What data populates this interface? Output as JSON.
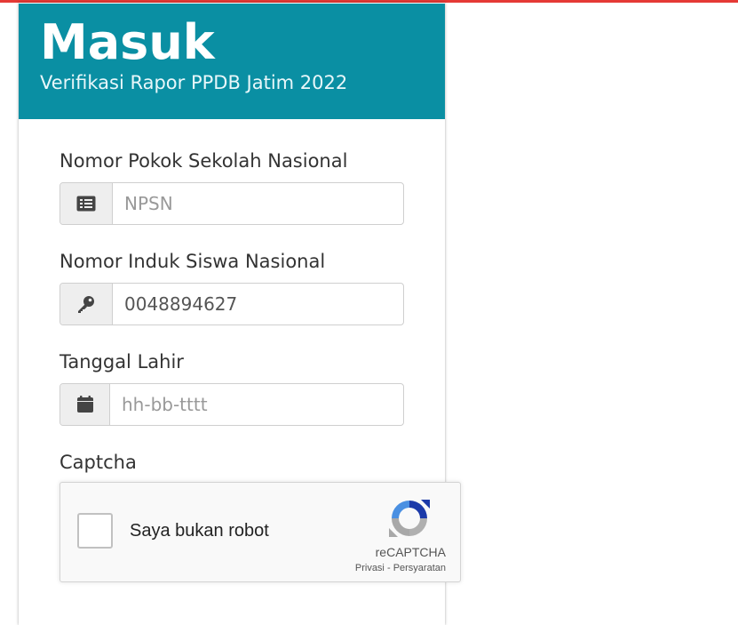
{
  "header": {
    "title": "Masuk",
    "subtitle": "Verifikasi Rapor PPDB Jatim 2022"
  },
  "form": {
    "npsn": {
      "label": "Nomor Pokok Sekolah Nasional",
      "placeholder": "NPSN",
      "value": "",
      "icon": "list-alt-icon"
    },
    "nisn": {
      "label": "Nomor Induk Siswa Nasional",
      "placeholder": "",
      "value": "0048894627",
      "icon": "key-icon"
    },
    "birthdate": {
      "label": "Tanggal Lahir",
      "placeholder": "hh-bb-tttt",
      "value": "",
      "icon": "calendar-icon"
    },
    "captcha": {
      "label": "Captcha",
      "checkbox_label": "Saya bukan robot",
      "brand": "reCAPTCHA",
      "privacy": "Privasi",
      "separator": "-",
      "terms": "Persyaratan"
    }
  },
  "colors": {
    "header_bg": "#0a8fa3",
    "top_bar": "#e53935"
  }
}
